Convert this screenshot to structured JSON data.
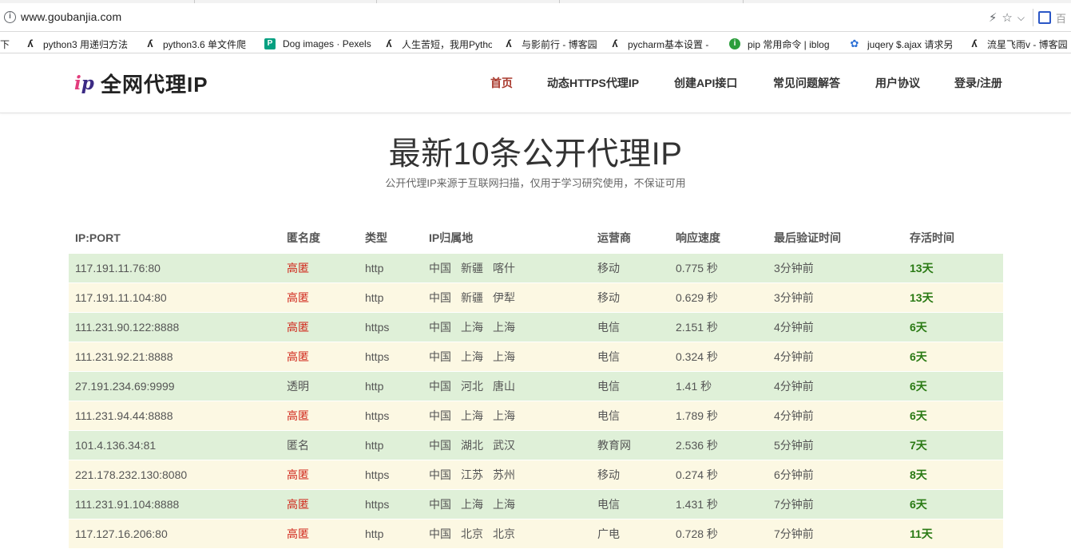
{
  "browser": {
    "url": "www.goubanjia.com",
    "bookmarks": [
      {
        "label": "下",
        "icon": "none"
      },
      {
        "label": "python3 用递归方法",
        "icon": "csdn-icon"
      },
      {
        "label": "python3.6 单文件爬",
        "icon": "csdn-icon"
      },
      {
        "label": "Dog images · Pexels",
        "icon": "pexels-icon"
      },
      {
        "label": "人生苦短，我用Pytho",
        "icon": "csdn-icon"
      },
      {
        "label": "与影前行 - 博客园",
        "icon": "csdn-icon"
      },
      {
        "label": "pycharm基本设置 - ",
        "icon": "csdn-icon"
      },
      {
        "label": "pip 常用命令 | iblog",
        "icon": "site-icon"
      },
      {
        "label": "juqery $.ajax 请求另",
        "icon": "baidu-paw-icon"
      },
      {
        "label": "流星飞雨v - 博客园",
        "icon": "csdn-icon"
      }
    ],
    "ext_text": "百"
  },
  "site": {
    "logo_mark": "ip",
    "logo_text": "全网代理IP",
    "nav": [
      {
        "label": "首页",
        "active": true
      },
      {
        "label": "动态HTTPS代理IP",
        "active": false
      },
      {
        "label": "创建API接口",
        "active": false
      },
      {
        "label": "常见问题解答",
        "active": false
      },
      {
        "label": "用户协议",
        "active": false
      },
      {
        "label": "登录/注册",
        "active": false
      }
    ]
  },
  "hero": {
    "title": "最新10条公开代理IP",
    "subtitle": "公开代理IP来源于互联网扫描，仅用于学习研究使用，不保证可用"
  },
  "table": {
    "headers": [
      "IP:PORT",
      "匿名度",
      "类型",
      "IP归属地",
      "运营商",
      "响应速度",
      "最后验证时间",
      "存活时间"
    ],
    "rows": [
      {
        "ip": "117.191.11.76:80",
        "anon": "高匿",
        "type": "http",
        "loc": [
          "中国",
          "新疆",
          "喀什"
        ],
        "isp": "移动",
        "speed": "0.775 秒",
        "checked": "3分钟前",
        "alive": "13天"
      },
      {
        "ip": "117.191.11.104:80",
        "anon": "高匿",
        "type": "http",
        "loc": [
          "中国",
          "新疆",
          "伊犁"
        ],
        "isp": "移动",
        "speed": "0.629 秒",
        "checked": "3分钟前",
        "alive": "13天"
      },
      {
        "ip": "111.231.90.122:8888",
        "anon": "高匿",
        "type": "https",
        "loc": [
          "中国",
          "上海",
          "上海"
        ],
        "isp": "电信",
        "speed": "2.151 秒",
        "checked": "4分钟前",
        "alive": "6天"
      },
      {
        "ip": "111.231.92.21:8888",
        "anon": "高匿",
        "type": "https",
        "loc": [
          "中国",
          "上海",
          "上海"
        ],
        "isp": "电信",
        "speed": "0.324 秒",
        "checked": "4分钟前",
        "alive": "6天"
      },
      {
        "ip": "27.191.234.69:9999",
        "anon": "透明",
        "type": "http",
        "loc": [
          "中国",
          "河北",
          "唐山"
        ],
        "isp": "电信",
        "speed": "1.41 秒",
        "checked": "4分钟前",
        "alive": "6天"
      },
      {
        "ip": "111.231.94.44:8888",
        "anon": "高匿",
        "type": "https",
        "loc": [
          "中国",
          "上海",
          "上海"
        ],
        "isp": "电信",
        "speed": "1.789 秒",
        "checked": "4分钟前",
        "alive": "6天"
      },
      {
        "ip": "101.4.136.34:81",
        "anon": "匿名",
        "type": "http",
        "loc": [
          "中国",
          "湖北",
          "武汉"
        ],
        "isp": "教育网",
        "speed": "2.536 秒",
        "checked": "5分钟前",
        "alive": "7天"
      },
      {
        "ip": "221.178.232.130:8080",
        "anon": "高匿",
        "type": "https",
        "loc": [
          "中国",
          "江苏",
          "苏州"
        ],
        "isp": "移动",
        "speed": "0.274 秒",
        "checked": "6分钟前",
        "alive": "8天"
      },
      {
        "ip": "111.231.91.104:8888",
        "anon": "高匿",
        "type": "https",
        "loc": [
          "中国",
          "上海",
          "上海"
        ],
        "isp": "电信",
        "speed": "1.431 秒",
        "checked": "7分钟前",
        "alive": "6天"
      },
      {
        "ip": "117.127.16.206:80",
        "anon": "高匿",
        "type": "http",
        "loc": [
          "中国",
          "北京",
          "北京"
        ],
        "isp": "广电",
        "speed": "0.728 秒",
        "checked": "7分钟前",
        "alive": "11天"
      }
    ]
  },
  "colors": {
    "row_green": "#dff0d8",
    "row_cream": "#fcf8e3",
    "anon_high": "#d0261a",
    "alive": "#2a7a14",
    "nav_active": "#a8382c"
  }
}
